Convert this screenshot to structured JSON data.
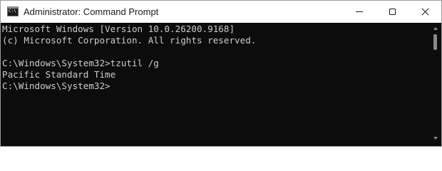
{
  "window": {
    "title": "Administrator: Command Prompt",
    "app_icon": "command-prompt-icon",
    "app_icon_text": "C:\\",
    "buttons": {
      "minimize": "minimize-icon",
      "maximize": "maximize-icon",
      "close": "close-icon"
    }
  },
  "console": {
    "lines": [
      "Microsoft Windows [Version 10.0.26200.9168]",
      "(c) Microsoft Corporation. All rights reserved.",
      "",
      "C:\\Windows\\System32>tzutil /g",
      "Pacific Standard Time",
      "C:\\Windows\\System32>"
    ]
  },
  "colors": {
    "console_background": "#0c0c0c",
    "console_text": "#cccccc",
    "titlebar_background": "#ffffff"
  }
}
